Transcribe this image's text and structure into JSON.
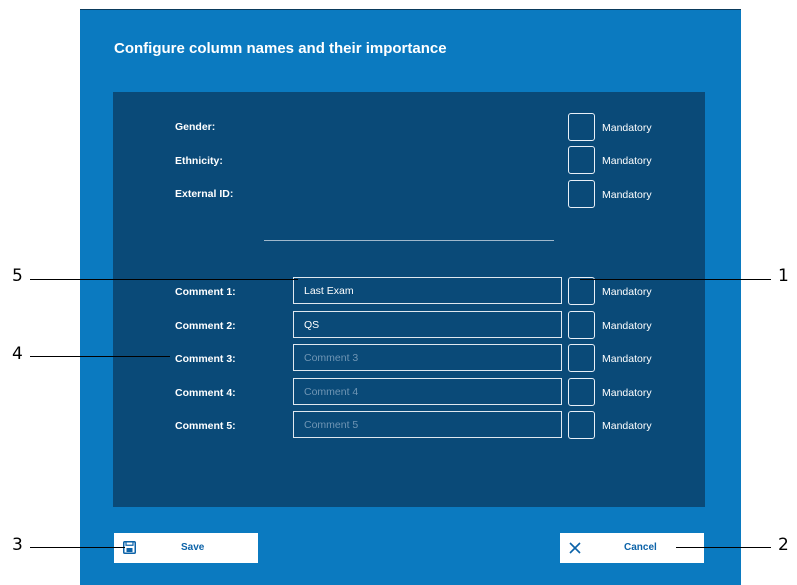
{
  "dialog": {
    "title": "Configure column names and their importance"
  },
  "fixed_rows": [
    {
      "label": "Gender:",
      "checkbox_label": "Mandatory",
      "checked": false
    },
    {
      "label": "Ethnicity:",
      "checkbox_label": "Mandatory",
      "checked": false
    },
    {
      "label": "External ID:",
      "checkbox_label": "Mandatory",
      "checked": false
    }
  ],
  "comment_rows": [
    {
      "label": "Comment 1:",
      "value": "Last Exam",
      "placeholder": "",
      "checkbox_label": "Mandatory",
      "checked": false
    },
    {
      "label": "Comment 2:",
      "value": "QS",
      "placeholder": "",
      "checkbox_label": "Mandatory",
      "checked": false
    },
    {
      "label": "Comment 3:",
      "value": "",
      "placeholder": "Comment 3",
      "checkbox_label": "Mandatory",
      "checked": false
    },
    {
      "label": "Comment 4:",
      "value": "",
      "placeholder": "Comment 4",
      "checkbox_label": "Mandatory",
      "checked": false
    },
    {
      "label": "Comment 5:",
      "value": "",
      "placeholder": "Comment 5",
      "checkbox_label": "Mandatory",
      "checked": false
    }
  ],
  "buttons": {
    "save_label": "Save",
    "cancel_label": "Cancel"
  },
  "callouts": [
    "1",
    "2",
    "3",
    "4",
    "5"
  ],
  "colors": {
    "dialog_bg": "#0b7ac0",
    "panel_bg": "#0a4a78",
    "button_text": "#0b62a8"
  }
}
